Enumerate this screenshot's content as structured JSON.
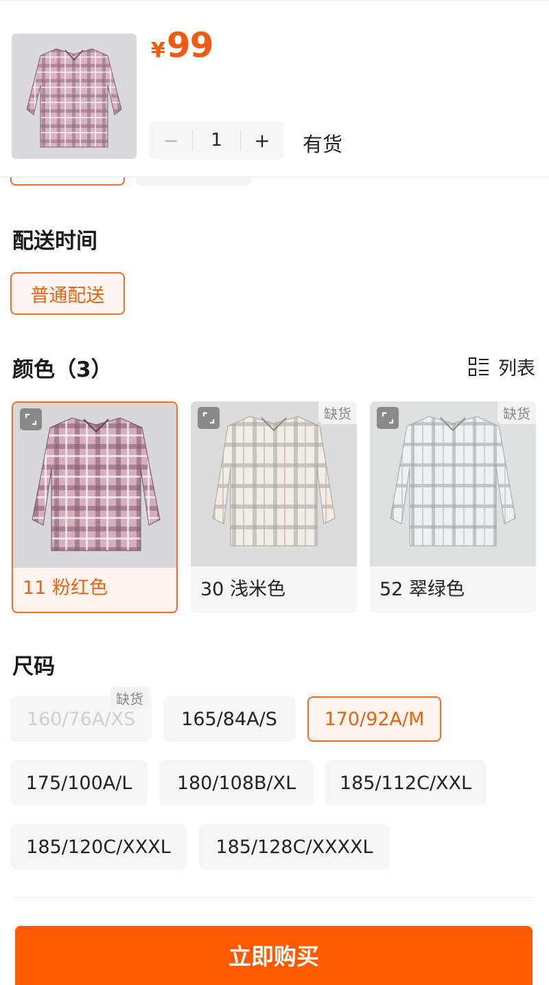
{
  "header": {
    "currency": "¥",
    "price": "99",
    "quantity": "1",
    "minus": "−",
    "plus": "+",
    "stock_status": "有货"
  },
  "delivery": {
    "title": "配送时间",
    "option": "普通配送"
  },
  "colors": {
    "title": "颜色（3）",
    "view_toggle": "列表",
    "items": [
      {
        "label": "11 粉红色",
        "selected": true,
        "oos": ""
      },
      {
        "label": "30 浅米色",
        "selected": false,
        "oos": "缺货"
      },
      {
        "label": "52 翠绿色",
        "selected": false,
        "oos": "缺货"
      }
    ]
  },
  "sizes": {
    "title": "尺码",
    "items": [
      {
        "label": "160/76A/XS",
        "state": "disabled",
        "oos": "缺货"
      },
      {
        "label": "165/84A/S",
        "state": "normal"
      },
      {
        "label": "170/92A/M",
        "state": "selected"
      },
      {
        "label": "175/100A/L",
        "state": "normal"
      },
      {
        "label": "180/108B/XL",
        "state": "normal"
      },
      {
        "label": "185/112C/XXL",
        "state": "normal"
      },
      {
        "label": "185/120C/XXXL",
        "state": "normal"
      },
      {
        "label": "185/128C/XXXXL",
        "state": "normal"
      }
    ]
  },
  "buy_button": "立即购买",
  "colors_palette": {
    "accent": "#f26c2a",
    "buy": "#ff5a00"
  }
}
